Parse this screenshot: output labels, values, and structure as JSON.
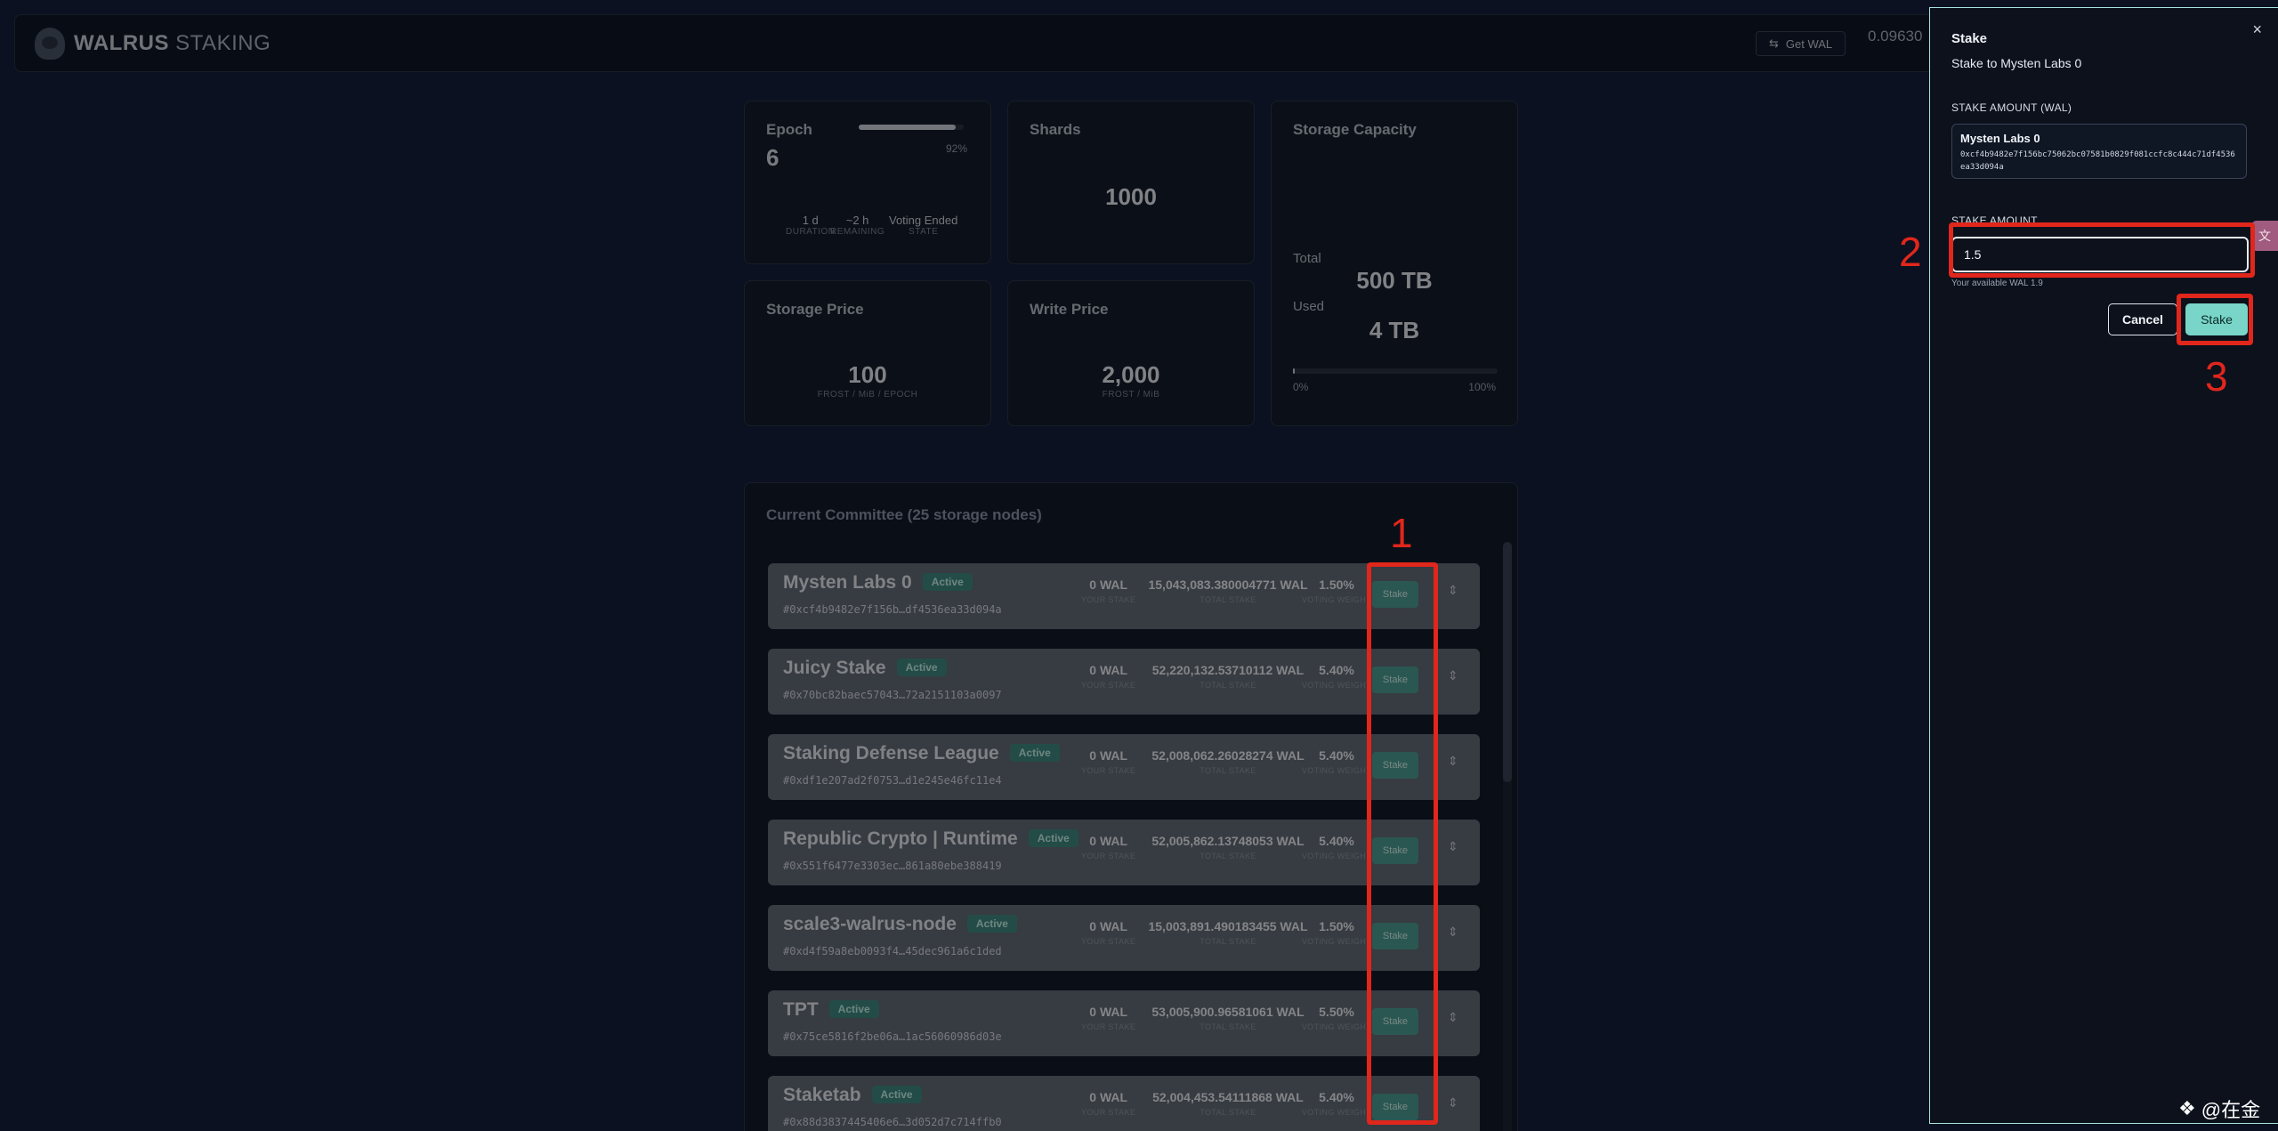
{
  "header": {
    "brand_bold": "WALRUS",
    "brand_light": " STAKING",
    "get_wal_label": "Get WAL",
    "balance_text": "0.09630"
  },
  "epoch": {
    "title": "Epoch",
    "value": "6",
    "progress_percent": 92,
    "progress_text": "92%",
    "duration_value": "1 d",
    "duration_label": "DURATION",
    "remaining_value": "~2 h",
    "remaining_label": "REMAINING",
    "state_value": "Voting Ended",
    "state_label": "STATE"
  },
  "shards": {
    "title": "Shards",
    "value": "1000"
  },
  "storage_capacity": {
    "title": "Storage Capacity",
    "total_label": "Total",
    "total_value": "500 TB",
    "used_label": "Used",
    "used_value": "4 TB",
    "used_fraction": 0.008,
    "min_label": "0%",
    "max_label": "100%"
  },
  "storage_price": {
    "title": "Storage Price",
    "value": "100",
    "unit": "FROST / MiB / EPOCH"
  },
  "write_price": {
    "title": "Write Price",
    "value": "2,000",
    "unit": "FROST / MiB"
  },
  "committee": {
    "title": "Current Committee (25 storage nodes)",
    "your_stake_label": "YOUR STAKE",
    "total_stake_label": "TOTAL STAKE",
    "voting_weight_label": "VOTING WEIGHT",
    "stake_button_label": "Stake",
    "sort_icon": "sort-icon",
    "nodes": [
      {
        "name": "Mysten Labs 0",
        "status": "Active",
        "address": "#0xcf4b9482e7f156b…df4536ea33d094a",
        "your_stake": "0 WAL",
        "total_stake": "15,043,083.380004771 WAL",
        "voting_weight": "1.50%"
      },
      {
        "name": "Juicy Stake",
        "status": "Active",
        "address": "#0x70bc82baec57043…72a2151103a0097",
        "your_stake": "0 WAL",
        "total_stake": "52,220,132.53710112 WAL",
        "voting_weight": "5.40%"
      },
      {
        "name": "Staking Defense League",
        "status": "Active",
        "address": "#0xdf1e207ad2f0753…d1e245e46fc11e4",
        "your_stake": "0 WAL",
        "total_stake": "52,008,062.26028274 WAL",
        "voting_weight": "5.40%"
      },
      {
        "name": "Republic Crypto | Runtime",
        "status": "Active",
        "address": "#0x551f6477e3303ec…861a80ebe388419",
        "your_stake": "0 WAL",
        "total_stake": "52,005,862.13748053 WAL",
        "voting_weight": "5.40%"
      },
      {
        "name": "scale3-walrus-node",
        "status": "Active",
        "address": "#0xd4f59a8eb0093f4…45dec961a6c1ded",
        "your_stake": "0 WAL",
        "total_stake": "15,003,891.490183455 WAL",
        "voting_weight": "1.50%"
      },
      {
        "name": "TPT",
        "status": "Active",
        "address": "#0x75ce5816f2be06a…1ac56060986d03e",
        "your_stake": "0 WAL",
        "total_stake": "53,005,900.96581061 WAL",
        "voting_weight": "5.50%"
      },
      {
        "name": "Staketab",
        "status": "Active",
        "address": "#0x88d3837445406e6…3d052d7c714ffb0",
        "your_stake": "0 WAL",
        "total_stake": "52,004,453.54111868 WAL",
        "voting_weight": "5.40%"
      }
    ]
  },
  "drawer": {
    "title": "Stake",
    "subtitle": "Stake to Mysten Labs 0",
    "amount_section_label": "STAKE AMOUNT (WAL)",
    "node_name": "Mysten Labs 0",
    "node_address": "0xcf4b9482e7f156bc75062bc07581b0829f081ccfc8c444c71df4536ea33d094a",
    "amount_label": "STAKE AMOUNT",
    "amount_value": "1.5",
    "available_text": "Your available WAL 1.9",
    "cancel_label": "Cancel",
    "stake_label": "Stake",
    "close_icon": "close-icon"
  },
  "annotations": {
    "step1": "1",
    "step2": "2",
    "step3": "3"
  },
  "watermark": "@在金",
  "colors": {
    "accent": "#78d5c8",
    "annotation": "#e1261c",
    "background": "#0b1120"
  }
}
